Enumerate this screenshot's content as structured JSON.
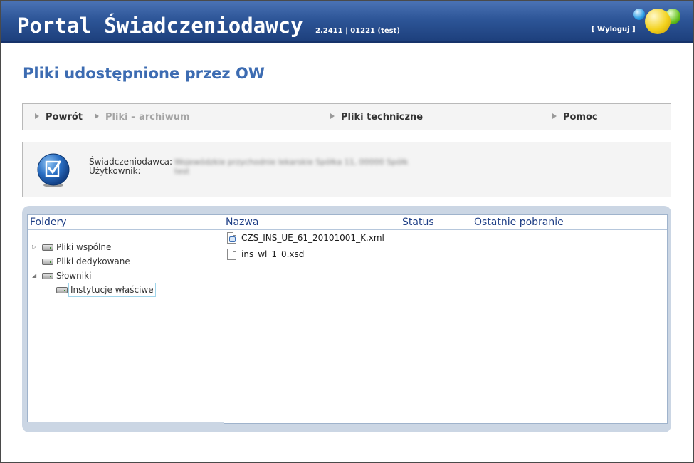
{
  "header": {
    "title": "Portal Świadczeniodawcy",
    "version": "2.2411 | 01221 (test)",
    "logout_label": "[ Wyloguj ]",
    "colors": {
      "bar": "#2d5597",
      "title_text": "#ffffff"
    }
  },
  "page": {
    "title": "Pliki udostępnione przez OW",
    "title_color": "#3d6cb2"
  },
  "nav": {
    "items": [
      {
        "label": "Powrót",
        "enabled": true
      },
      {
        "label": "Pliki – archiwum",
        "enabled": false
      },
      {
        "label": "Pliki techniczne",
        "enabled": true
      },
      {
        "label": "Pomoc",
        "enabled": true
      }
    ]
  },
  "info": {
    "icon": "document-check-icon",
    "provider_label": "Świadczeniodawca:",
    "user_label": "Użytkownik:",
    "provider_value": "Wojewódzkie przychodnie lekarskie Spółka 11, 00000 Spółk",
    "user_value": "test"
  },
  "browser": {
    "folders_header": "Foldery",
    "columns": {
      "name": "Nazwa",
      "status": "Status",
      "last_download": "Ostatnie pobranie"
    },
    "tree": [
      {
        "label": "Pliki wspólne",
        "toggle": "collapsed",
        "icon": "drive-icon"
      },
      {
        "label": "Pliki dedykowane",
        "toggle": "none",
        "icon": "drive-icon"
      },
      {
        "label": "Słowniki",
        "toggle": "expanded",
        "icon": "drive-icon"
      },
      {
        "label": "Instytucje właściwe",
        "toggle": "none",
        "icon": "drive-icon",
        "selected": true
      }
    ],
    "files": [
      {
        "name": "CZS_INS_UE_61_20101001_K.xml",
        "icon": "xml-file-icon",
        "status": "",
        "last_download": ""
      },
      {
        "name": "ins_wl_1_0.xsd",
        "icon": "file-icon",
        "status": "",
        "last_download": ""
      }
    ],
    "colors": {
      "panel_bg": "#cbd6e4",
      "header_text": "#1f3f86"
    }
  }
}
